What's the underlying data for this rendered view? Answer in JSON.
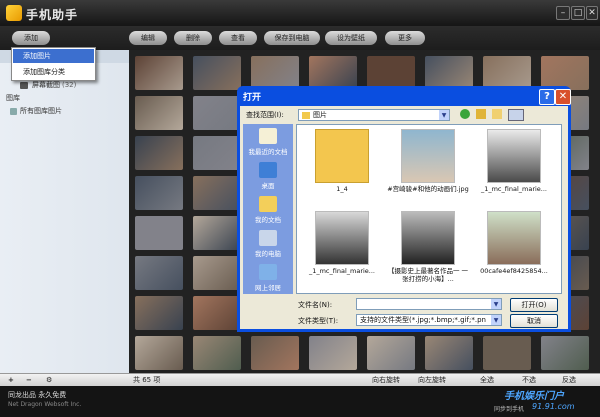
{
  "app": {
    "title": "手机助手",
    "footer_line1": "同龙出品 永久免费",
    "footer_line2": "Net Dragon Websoft Inc.",
    "footer_sync": "同步到手机",
    "watermark": "手机娱乐门户",
    "watermark_url": "91.91.com"
  },
  "window_controls": {
    "minimize": "–",
    "maximize": "□",
    "close": "✕"
  },
  "toolbar": {
    "add": "添加",
    "edit": "编辑",
    "delete": "删除",
    "view": "查看",
    "save_to_pc": "保存到电脑",
    "set_wallpaper": "设为壁纸",
    "more": "更多"
  },
  "add_menu": {
    "items": [
      "添加图片",
      "添加图库分类"
    ]
  },
  "sidebar": {
    "screenshot_item": "屏幕截图",
    "screenshot_count": "(32)",
    "library_label": "图库",
    "all_library": "所有图库图片"
  },
  "statusbar": {
    "total": "共 65 项",
    "rotate_right": "向右旋转",
    "rotate_left": "向左旋转",
    "select_all": "全选",
    "unselect": "不选",
    "invert": "反选"
  },
  "open_dialog": {
    "title": "打开",
    "help": "?",
    "close": "✕",
    "look_in_label": "查找范围(I):",
    "look_in_value": "图片",
    "places": [
      "我最近的文档",
      "桌面",
      "我的文档",
      "我的电脑",
      "网上邻居"
    ],
    "files": [
      {
        "name": "1_4",
        "kind": "folder"
      },
      {
        "name": "#宫崎骏#和他的动画们.jpg",
        "kind": "image"
      },
      {
        "name": "_1_mc_final_marie...",
        "kind": "image"
      },
      {
        "name": "_1_mc_final_marie...",
        "kind": "image"
      },
      {
        "name": "【摄影史上最著名作品一 一张打捞的小海】...",
        "kind": "image"
      },
      {
        "name": "00cafe4ef8425854...",
        "kind": "image"
      }
    ],
    "filename_label": "文件名(N):",
    "filename_value": "",
    "filetype_label": "文件类型(T):",
    "filetype_value": "支持的文件类型(*.jpg;*.bmp;*.gif;*.pn",
    "open_button": "打开(O)",
    "cancel_button": "取消"
  },
  "colors": {
    "dialog_title": "#0a4ee0",
    "menu_selected": "#3c6fcf",
    "places_bar": "#7c9ce0"
  }
}
